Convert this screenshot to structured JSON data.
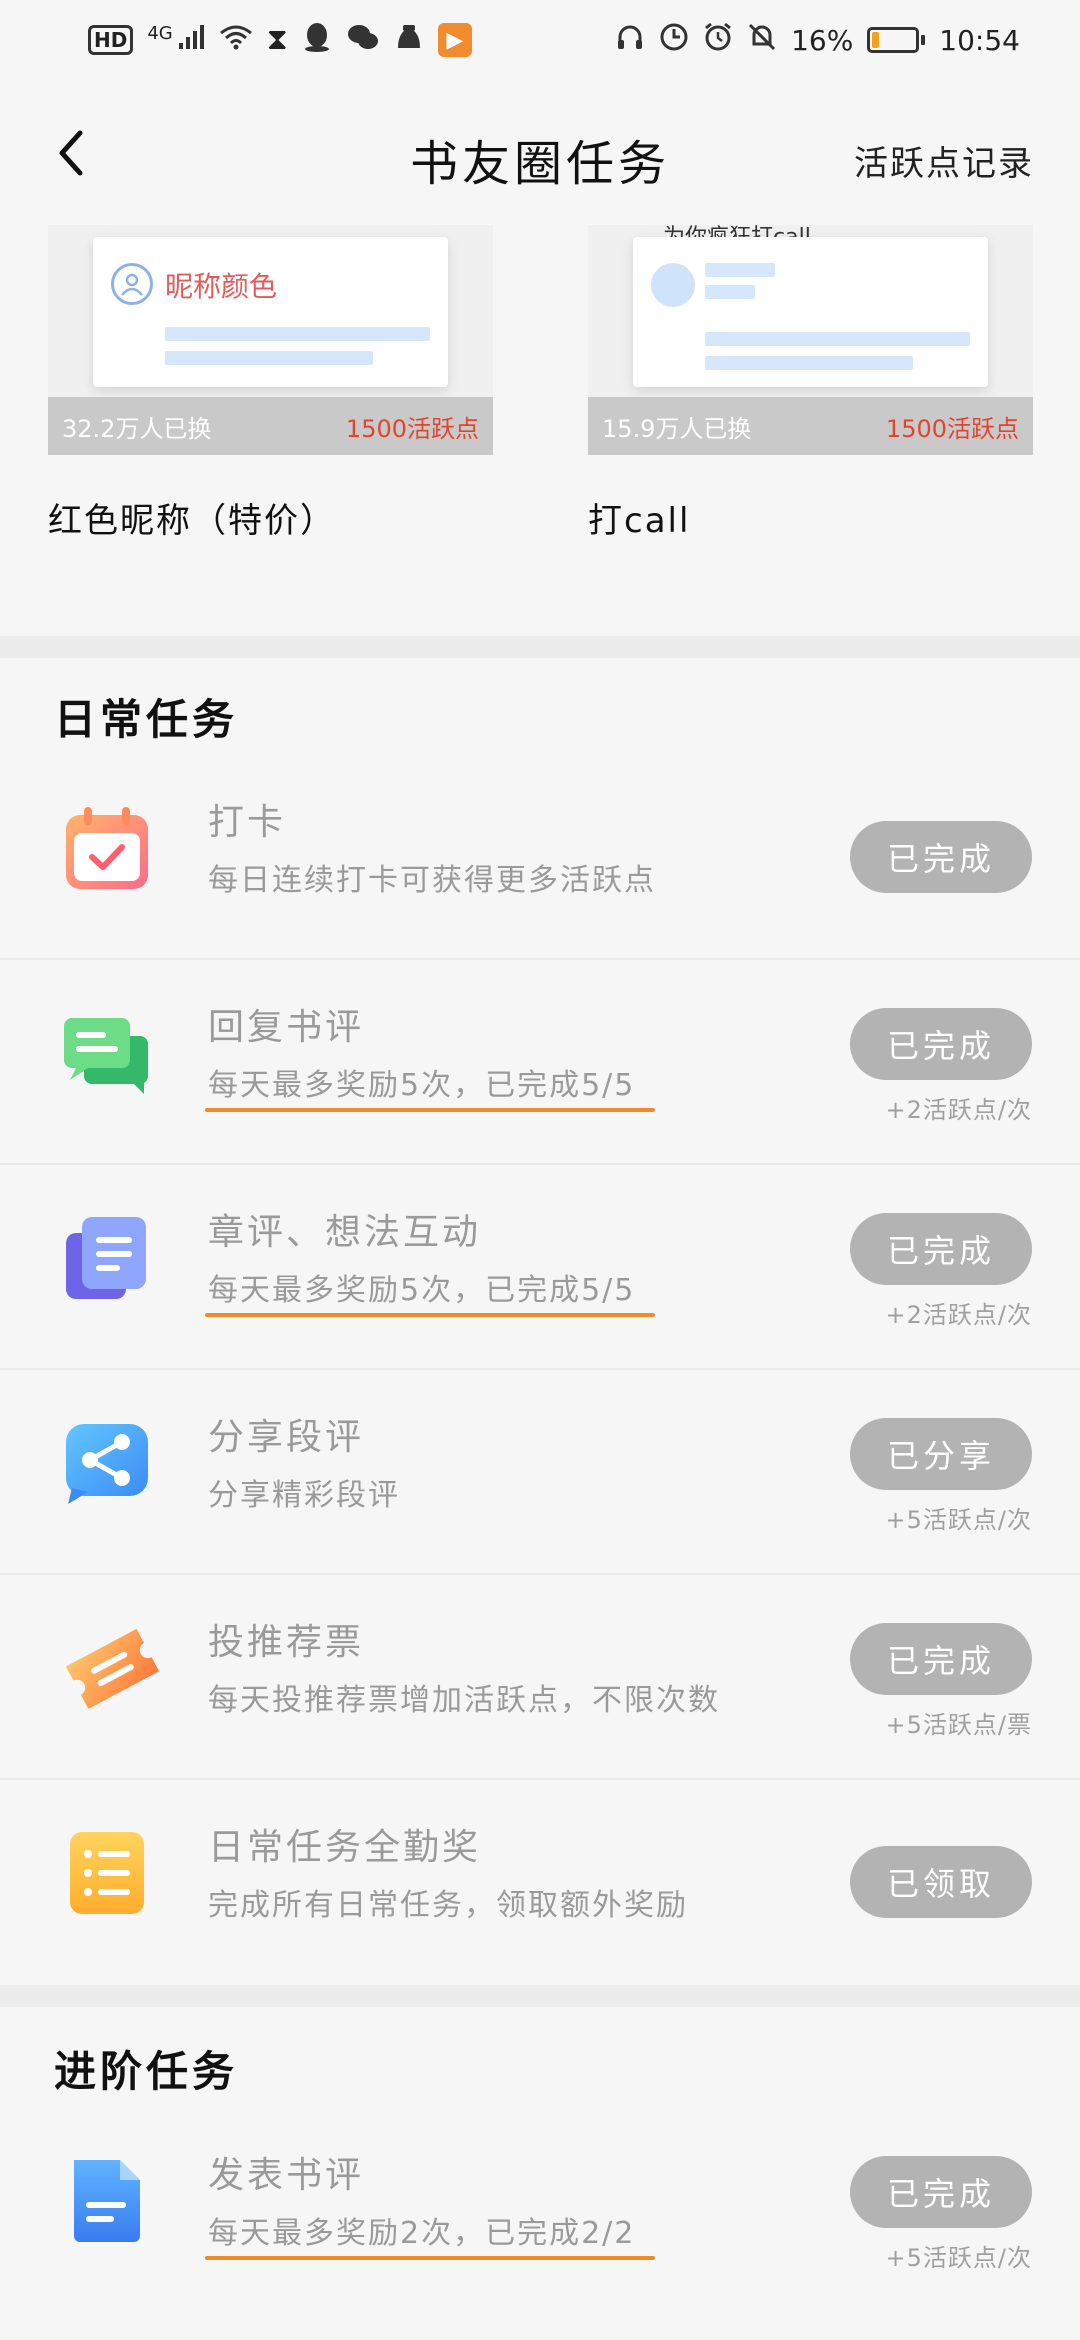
{
  "status_bar": {
    "network": "4G",
    "hd_label": "HD",
    "battery": "16%",
    "time": "10:54",
    "battery_level": 0.16,
    "icons": [
      "hd-icon",
      "signal-icon",
      "wifi-icon",
      "hourglass-icon",
      "qq-icon",
      "wechat-icon",
      "app-icon",
      "video-app-icon",
      "headphone-icon",
      "data-saver-icon",
      "alarm-icon",
      "mute-icon",
      "battery-icon"
    ]
  },
  "header": {
    "back_icon": "back-chevron-icon",
    "title": "书友圈任务",
    "right_link": "活跃点记录"
  },
  "rewards": [
    {
      "preview_text": "昵称颜色",
      "count": "32.2万人已换",
      "price": "1500活跃点",
      "name": "红色昵称（特价）"
    },
    {
      "preview_text": "为你疯狂打call",
      "count": "15.9万人已换",
      "price": "1500活跃点",
      "name": "打call"
    }
  ],
  "daily": {
    "title": "日常任务",
    "tasks": [
      {
        "icon": "calendar-check-icon",
        "title": "打卡",
        "desc": "每日连续打卡可获得更多活跃点",
        "button": "已完成",
        "reward": ""
      },
      {
        "icon": "chat-bubble-icon",
        "title": "回复书评",
        "desc": "每天最多奖励5次，已完成5/5",
        "button": "已完成",
        "reward": "+2活跃点/次"
      },
      {
        "icon": "document-stack-icon",
        "title": "章评、想法互动",
        "desc": "每天最多奖励5次，已完成5/5",
        "button": "已完成",
        "reward": "+2活跃点/次"
      },
      {
        "icon": "share-icon",
        "title": "分享段评",
        "desc": "分享精彩段评",
        "button": "已分享",
        "reward": "+5活跃点/次"
      },
      {
        "icon": "ticket-icon",
        "title": "投推荐票",
        "desc": "每天投推荐票增加活跃点，不限次数",
        "button": "已完成",
        "reward": "+5活跃点/票"
      },
      {
        "icon": "list-icon",
        "title": "日常任务全勤奖",
        "desc": "完成所有日常任务，领取额外奖励",
        "button": "已领取",
        "reward": ""
      }
    ]
  },
  "advanced": {
    "title": "进阶任务",
    "tasks": [
      {
        "icon": "doc-edit-icon",
        "title": "发表书评",
        "desc": "每天最多奖励2次，已完成2/2",
        "button": "已完成",
        "reward": "+5活跃点/次"
      }
    ]
  },
  "colors": {
    "accent_orange": "#ee8c2c",
    "price_red": "#e2452e",
    "button_gray": "#b3b3b3"
  }
}
